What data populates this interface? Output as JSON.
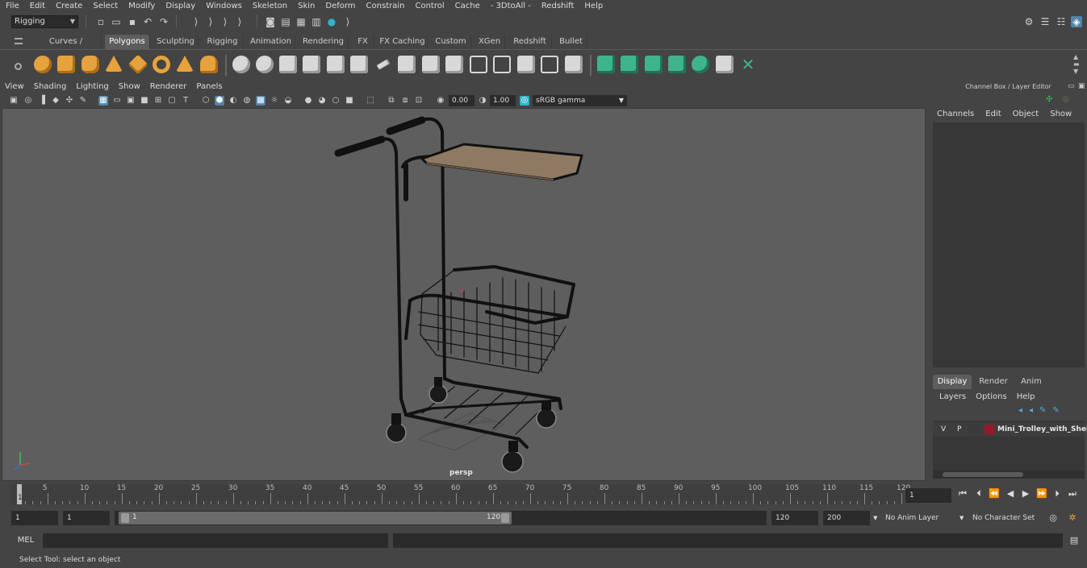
{
  "menubar": [
    "File",
    "Edit",
    "Create",
    "Select",
    "Modify",
    "Display",
    "Windows",
    "Skeleton",
    "Skin",
    "Deform",
    "Constrain",
    "Control",
    "Cache",
    "- 3DtoAll -",
    "Redshift",
    "Help"
  ],
  "status_line": {
    "menu_set": "Rigging"
  },
  "shelf": {
    "tabs": [
      "Curves / Surfaces",
      "Polygons",
      "Sculpting",
      "Rigging",
      "Animation",
      "Rendering",
      "FX",
      "FX Caching",
      "Custom",
      "XGen",
      "Redshift",
      "Bullet"
    ],
    "active_tab": "Polygons",
    "icons": [
      "poly-sphere-icon",
      "poly-cube-icon",
      "poly-cylinder-icon",
      "poly-cone-icon",
      "poly-diamond-icon",
      "poly-torus-icon",
      "poly-prism-icon",
      "poly-pipe-icon",
      "combine-icon",
      "separate-icon",
      "extract-icon",
      "smooth-icon",
      "boolean-icon",
      "mirror-icon",
      "fill-hole-icon",
      "bevel-icon",
      "bridge-icon",
      "extrude-icon",
      "multi-cut-icon",
      "insert-edge-loop-icon",
      "merge-icon",
      "append-icon",
      "planar-map-icon",
      "automatic-map-icon",
      "uv-editor-icon",
      "transfer-attr-icon",
      "lattice-icon",
      "texture-editor-icon",
      "checker-icon",
      "snap-icon"
    ]
  },
  "viewport": {
    "menu": [
      "View",
      "Shading",
      "Lighting",
      "Show",
      "Renderer",
      "Panels"
    ],
    "exposure": "0.00",
    "gamma": "1.00",
    "color_space": "sRGB gamma",
    "camera": "persp"
  },
  "right_panel": {
    "title": "Channel Box / Layer Editor",
    "channel_menu": [
      "Channels",
      "Edit",
      "Object",
      "Show"
    ],
    "layer_tabs": [
      "Display",
      "Render",
      "Anim"
    ],
    "active_layer_tab": "Display",
    "layer_menu": [
      "Layers",
      "Options",
      "Help"
    ],
    "layers": [
      {
        "v": "V",
        "p": "P",
        "name": "Mini_Trolley_with_Shelf_",
        "color": "#a0142e"
      }
    ]
  },
  "timeline": {
    "ticks": [
      "5",
      "10",
      "15",
      "20",
      "25",
      "30",
      "35",
      "40",
      "45",
      "50",
      "55",
      "60",
      "65",
      "70",
      "75",
      "80",
      "85",
      "90",
      "95",
      "100",
      "105",
      "110",
      "115",
      "120"
    ],
    "current_frame": "1",
    "marker_label": "1"
  },
  "range": {
    "start": "1",
    "playback_start": "1",
    "range_start_label": "1",
    "range_end_label": "120",
    "playback_end": "120",
    "end": "200",
    "anim_layer": "No Anim Layer",
    "character_set": "No Character Set"
  },
  "command": {
    "label": "MEL"
  },
  "help_line": "Select Tool: select an object"
}
